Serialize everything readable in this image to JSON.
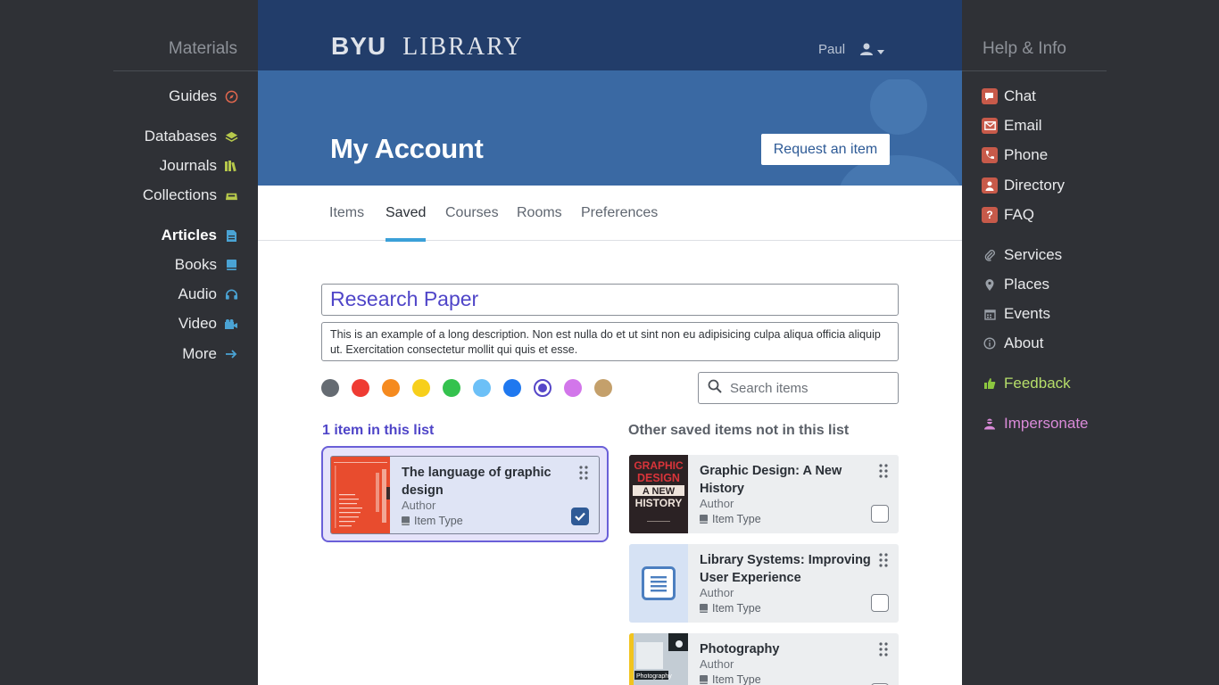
{
  "left_nav": {
    "heading": "Materials",
    "items": [
      {
        "label": "Guides",
        "icon": "compass-icon"
      },
      {
        "label": "Databases",
        "icon": "layers-icon"
      },
      {
        "label": "Journals",
        "icon": "books-icon"
      },
      {
        "label": "Collections",
        "icon": "archive-icon"
      },
      {
        "label": "Articles",
        "icon": "document-icon"
      },
      {
        "label": "Books",
        "icon": "book-icon"
      },
      {
        "label": "Audio",
        "icon": "headphones-icon"
      },
      {
        "label": "Video",
        "icon": "video-icon"
      },
      {
        "label": "More",
        "icon": "arrow-right-icon"
      }
    ]
  },
  "right_nav": {
    "heading": "Help & Info",
    "items": [
      {
        "label": "Chat",
        "icon": "chat-icon"
      },
      {
        "label": "Email",
        "icon": "email-icon"
      },
      {
        "label": "Phone",
        "icon": "phone-icon"
      },
      {
        "label": "Directory",
        "icon": "directory-icon"
      },
      {
        "label": "FAQ",
        "icon": "question-icon"
      },
      {
        "label": "Services",
        "icon": "paperclip-icon"
      },
      {
        "label": "Places",
        "icon": "map-pin-icon"
      },
      {
        "label": "Events",
        "icon": "calendar-icon"
      },
      {
        "label": "About",
        "icon": "info-icon"
      },
      {
        "label": "Feedback",
        "icon": "thumbs-up-icon"
      },
      {
        "label": "Impersonate",
        "icon": "user-mask-icon"
      }
    ]
  },
  "header": {
    "logo_brand": "BYU",
    "logo_text": "LIBRARY",
    "user_name": "Paul"
  },
  "hero": {
    "title": "My Account",
    "request_button": "Request an item"
  },
  "tabs": [
    {
      "label": "Items",
      "active": false
    },
    {
      "label": "Saved",
      "active": true
    },
    {
      "label": "Courses",
      "active": false
    },
    {
      "label": "Rooms",
      "active": false
    },
    {
      "label": "Preferences",
      "active": false
    }
  ],
  "list": {
    "title": "Research Paper",
    "description": "This is an example of a long description. Non est nulla do et ut sint non eu adipisicing culpa aliqua officia aliquip ut. Exercitation consectetur mollit qui quis et esse.",
    "colors": [
      "#656b72",
      "#ef3b33",
      "#f58a1f",
      "#f7cf1b",
      "#34c24e",
      "#6cc0f7",
      "#1f78ef",
      "#5546c8",
      "#d276ea",
      "#c4a06b"
    ],
    "selected_color_index": 7,
    "search_placeholder": "Search items"
  },
  "in_list": {
    "heading": "1 item in this list",
    "items": [
      {
        "title": "The language of graphic design",
        "author": "Author",
        "type": "Item Type",
        "checked": true
      }
    ]
  },
  "other": {
    "heading": "Other saved items not in this list",
    "items": [
      {
        "title": "Graphic Design: A New History",
        "author": "Author",
        "type": "Item Type",
        "checked": false,
        "cover_text": [
          "GRAPHIC",
          "DESIGN",
          "A NEW",
          "HISTORY"
        ]
      },
      {
        "title": "Library Systems: Improving User Experience",
        "author": "Author",
        "type": "Item Type",
        "checked": false
      },
      {
        "title": "Photography",
        "author": "Author",
        "type": "Item Type",
        "checked": false,
        "cover_label": "Photography"
      }
    ]
  }
}
